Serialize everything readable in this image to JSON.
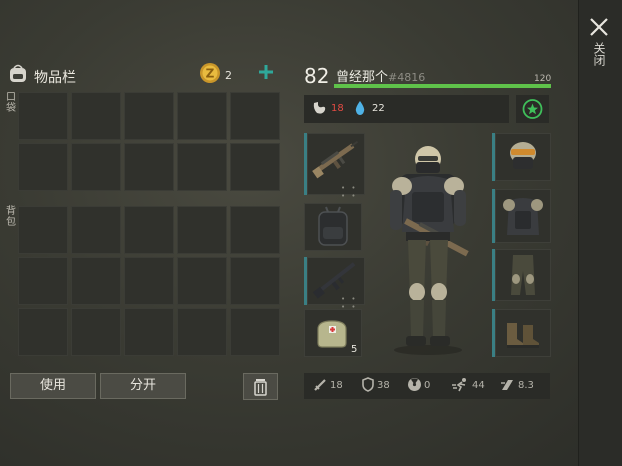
{
  "close": {
    "label": "关闭",
    "icon": "close-icon"
  },
  "inventory": {
    "title": "物品栏",
    "currency_icon": "gold-coin-icon",
    "coins": "2",
    "pocket_label": "口袋",
    "backpack_label": "背包",
    "use_label": "使用",
    "split_label": "分开"
  },
  "character": {
    "level": "82",
    "name": "曾经那个",
    "id": "#4816",
    "xp_max": "120",
    "xp_fraction": 1.0,
    "food": "18",
    "water": "22"
  },
  "equipment": {
    "weapon1_dots": "• • • •",
    "weapon2_dots": "• • • •",
    "medkit_qty": "5"
  },
  "stats": {
    "attack": "18",
    "defense": "38",
    "radiation": "0",
    "speed": "44",
    "stealth": "8.3"
  },
  "colors": {
    "xp": "#5fc24a",
    "accent": "#3a7f84",
    "food": "#e24b43",
    "plus": "#2fa89a",
    "star": "#3fbf5a"
  }
}
